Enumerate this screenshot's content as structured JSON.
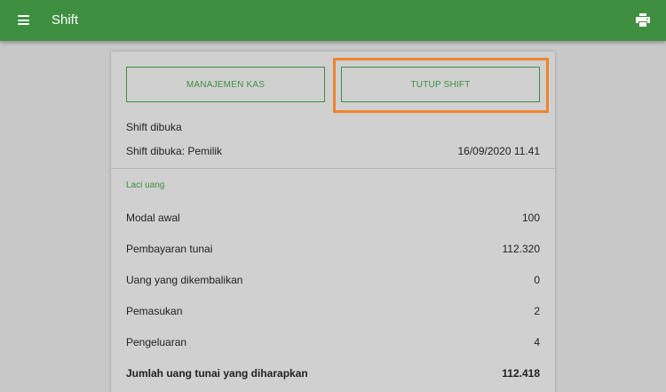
{
  "appbar": {
    "title": "Shift",
    "menu_icon": "menu-icon",
    "print_icon": "print-icon",
    "color": "#3f8f41"
  },
  "actions": {
    "cash_management_label": "MANAJEMEN KAS",
    "close_shift_label": "TUTUP SHIFT",
    "highlight_color": "#f0842c"
  },
  "shift_info": {
    "opened_label": "Shift dibuka",
    "opened_by_label": "Shift dibuka: Pemilik",
    "opened_at": "16/09/2020 11.41"
  },
  "cash_drawer": {
    "section_title": "Laci uang",
    "rows": [
      {
        "label": "Modal awal",
        "value": "100"
      },
      {
        "label": "Pembayaran tunai",
        "value": "112.320"
      },
      {
        "label": "Uang yang dikembalikan",
        "value": "0"
      },
      {
        "label": "Pemasukan",
        "value": "2"
      },
      {
        "label": "Pengeluaran",
        "value": "4"
      }
    ],
    "expected_label": "Jumlah uang tunai yang diharapkan",
    "expected_value": "112.418"
  }
}
